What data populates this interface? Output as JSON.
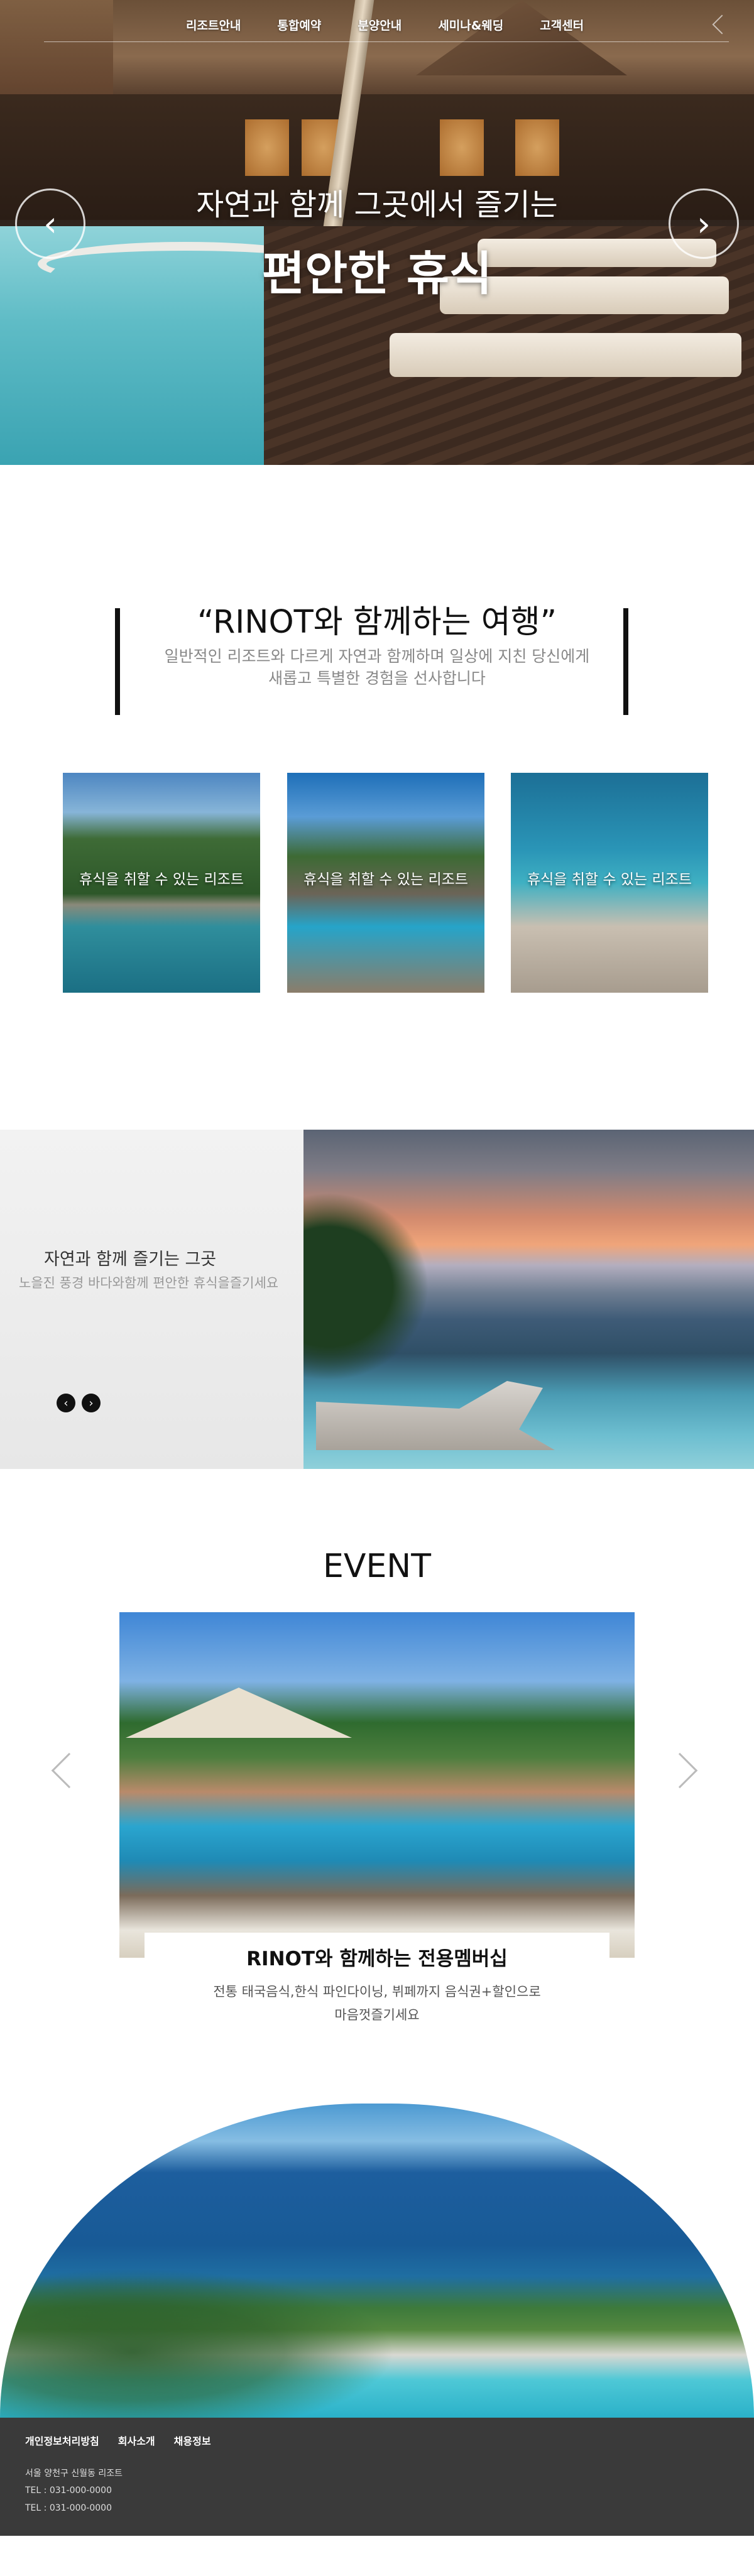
{
  "nav": {
    "menu": [
      "리조트안내",
      "통합예약",
      "분양안내",
      "세미나&웨딩",
      "고객센터"
    ]
  },
  "hero": {
    "subtitle": "자연과 함께 그곳에서 즐기는",
    "title": "편안한 휴식",
    "prev_icon": "chevron-left-icon",
    "next_icon": "chevron-right-icon"
  },
  "intro": {
    "title": "“RINOT와 함께하는 여행”",
    "line1": "일반적인 리조트와 다르게 자연과 함께하며 일상에 지친 당신에게",
    "line2": "새롭고 특별한 경험을 선사합니다"
  },
  "cards": [
    {
      "label": "휴식을 취할 수 있는 리조트"
    },
    {
      "label": "휴식을 취할 수 있는 리조트"
    },
    {
      "label": "휴식을 취할 수 있는 리조트"
    }
  ],
  "promo": {
    "title": "자연과 함께 즐기는 그곳",
    "desc": "노을진 풍경 바다와함께 편안한 휴식을즐기세요",
    "prev": "‹",
    "next": "›"
  },
  "event": {
    "heading": "EVENT",
    "card_title": "RINOT와 함께하는 전용멤버십",
    "desc1": "전통 태국음식,한식 파인다이닝, 뷔페까지 음식권+할인으로",
    "desc2": "마음껏즐기세요"
  },
  "footer": {
    "links": [
      "개인정보처리방침",
      "회사소개",
      "채용정보"
    ],
    "address": "서울 양천구 신월동 리조트",
    "tel1": "TEL : 031-000-0000",
    "tel2": "TEL : 031-000-0000"
  }
}
